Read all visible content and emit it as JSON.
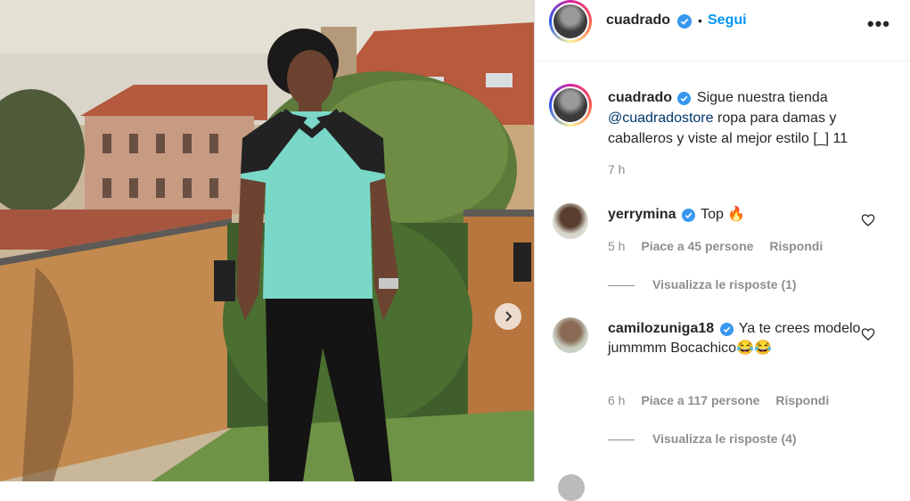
{
  "post": {
    "username": "cuadrado",
    "follow_label": "Segui",
    "more_label": "•••",
    "caption_text": "Sigue nuestra tienda",
    "caption_mention": "@cuadradostore",
    "caption_rest": "ropa para damas y caballeros y viste al mejor estilo [_] 11",
    "time": "7 h"
  },
  "comments": [
    {
      "username": "yerrymina",
      "text": "Top 🔥",
      "time": "5 h",
      "likes": "Piace a 45 persone",
      "reply_label": "Rispondi",
      "view_replies": "Visualizza le risposte (1)"
    },
    {
      "username": "camilozuniga18",
      "text": "Ya te crees modelo jummmm Bocachico😂😂",
      "time": "6 h",
      "likes": "Piace a 117 persone",
      "reply_label": "Rispondi",
      "view_replies": "Visualizza le risposte (4)"
    }
  ],
  "colors": {
    "follow_blue": "#0095f6",
    "verified_blue": "#3897f0",
    "text": "#262626",
    "meta_gray": "#8e8e8e"
  },
  "icons": [
    "verified-badge-icon",
    "more-options-icon",
    "heart-icon",
    "chevron-right-icon"
  ]
}
